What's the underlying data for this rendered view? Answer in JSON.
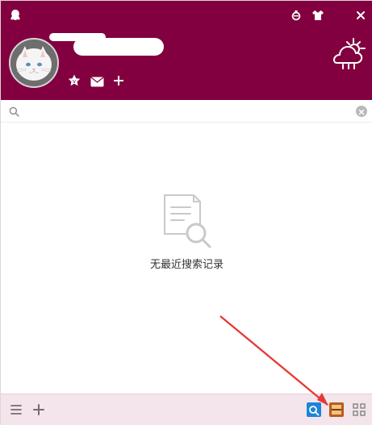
{
  "window": {
    "title": "QQ",
    "search_placeholder": "",
    "empty_state": "无最近搜索记录"
  },
  "header": {
    "icons": [
      "qq-penguin-icon",
      "skin-icon",
      "shirt-icon",
      "close-icon",
      "star-icon",
      "mail-icon",
      "plus-icon",
      "weather-icon"
    ]
  },
  "footer": {
    "icons": [
      "menu-icon",
      "add-icon",
      "baidu-icon",
      "app-icon",
      "grid-icon"
    ]
  },
  "colors": {
    "header": "#82003f",
    "footer": "#f3e5eb",
    "search_border": "#ececec",
    "arrow": "#e53935"
  }
}
